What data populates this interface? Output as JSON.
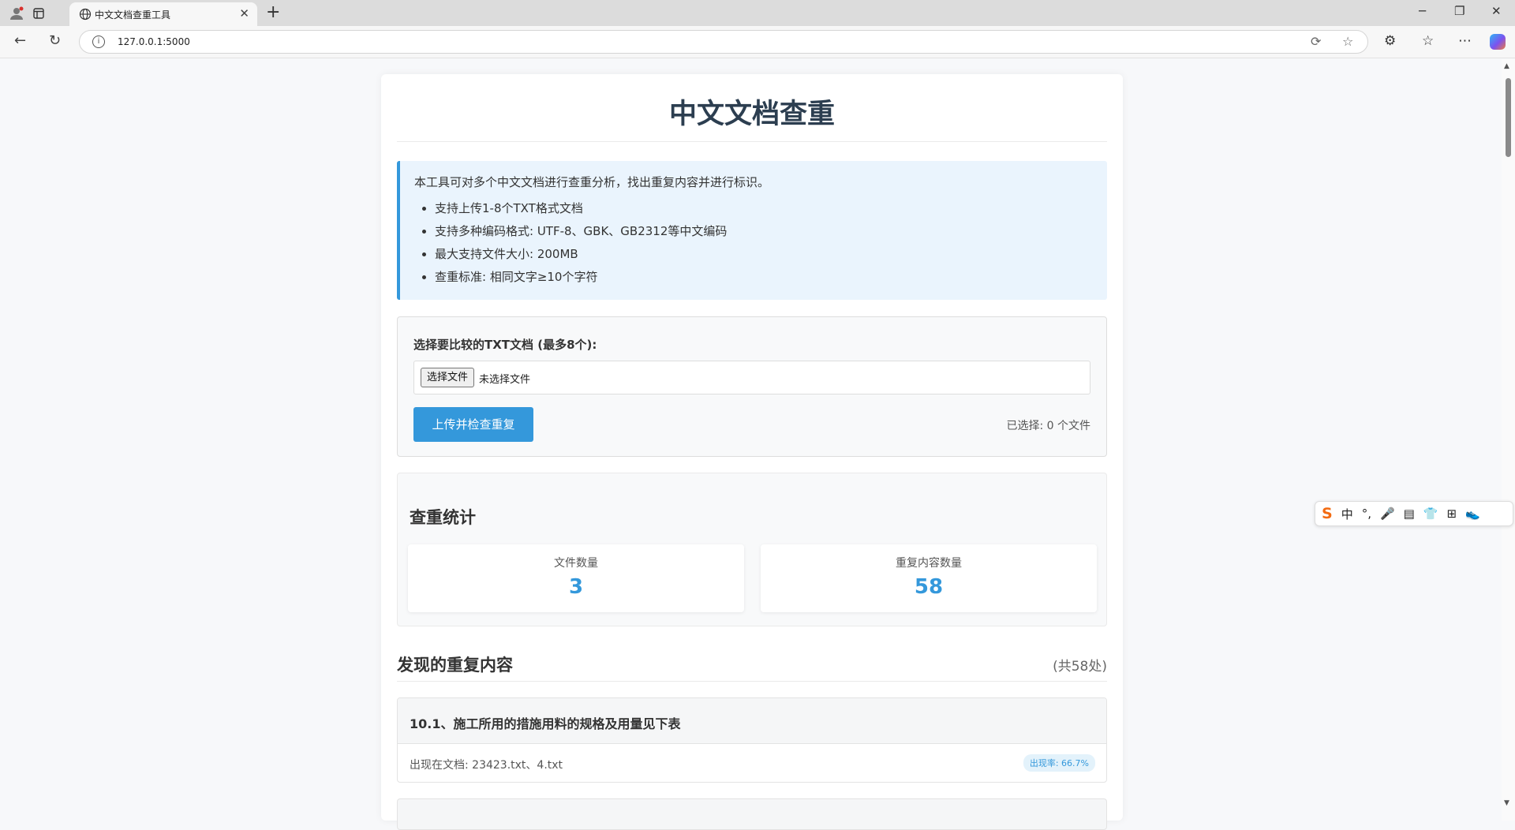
{
  "browser": {
    "tab_title": "中文文档查重工具",
    "url": "127.0.0.1:5000"
  },
  "page": {
    "title": "中文文档查重",
    "intro": "本工具可对多个中文文档进行查重分析，找出重复内容并进行标识。",
    "features": [
      "支持上传1-8个TXT格式文档",
      "支持多种编码格式: UTF-8、GBK、GB2312等中文编码",
      "最大支持文件大小: 200MB",
      "查重标准: 相同文字≥10个字符"
    ]
  },
  "upload": {
    "label": "选择要比较的TXT文档 (最多8个):",
    "choose_button": "选择文件",
    "no_file_text": "未选择文件",
    "submit_button": "上传并检查重复",
    "selected_count": "已选择: 0 个文件"
  },
  "stats": {
    "title": "查重统计",
    "items": [
      {
        "label": "文件数量",
        "value": "3"
      },
      {
        "label": "重复内容数量",
        "value": "58"
      }
    ]
  },
  "duplicates": {
    "title": "发现的重复内容",
    "count_text": "(共58处)",
    "items": [
      {
        "text": "10.1、施工所用的措施用料的规格及用量见下表",
        "docs": "出现在文档: 23423.txt、4.txt",
        "rate": "出现率: 66.7%"
      }
    ]
  },
  "ime": {
    "items": [
      "中",
      "°,",
      "🎤",
      "▤",
      "👕",
      "⊞",
      "👟"
    ]
  },
  "colors": {
    "accent": "#3498db",
    "title": "#2c3e50",
    "info_bg": "#eaf4fd"
  }
}
